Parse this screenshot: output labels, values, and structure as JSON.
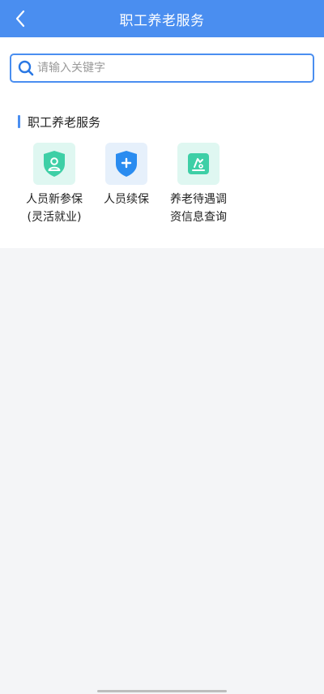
{
  "header": {
    "title": "职工养老服务",
    "back_icon": "chevron-left-icon"
  },
  "search": {
    "placeholder": "请输入关键字",
    "value": "",
    "icon": "search-icon"
  },
  "section": {
    "title": "职工养老服务",
    "items": [
      {
        "label": "人员新参保\n(灵活就业)",
        "icon": "person-shield-icon",
        "icon_bg": "#dff7f1",
        "icon_color": "#3ecfa6"
      },
      {
        "label": "人员续保",
        "icon": "plus-shield-icon",
        "icon_bg": "#e6f0fb",
        "icon_color": "#2a8cf0"
      },
      {
        "label": "养老待遇调\n资信息查询",
        "icon": "document-edit-icon",
        "icon_bg": "#dff7f1",
        "icon_color": "#3ecfa6"
      }
    ]
  },
  "colors": {
    "accent": "#4a8ef0",
    "background": "#f4f5f7",
    "teal": "#3ecfa6"
  }
}
